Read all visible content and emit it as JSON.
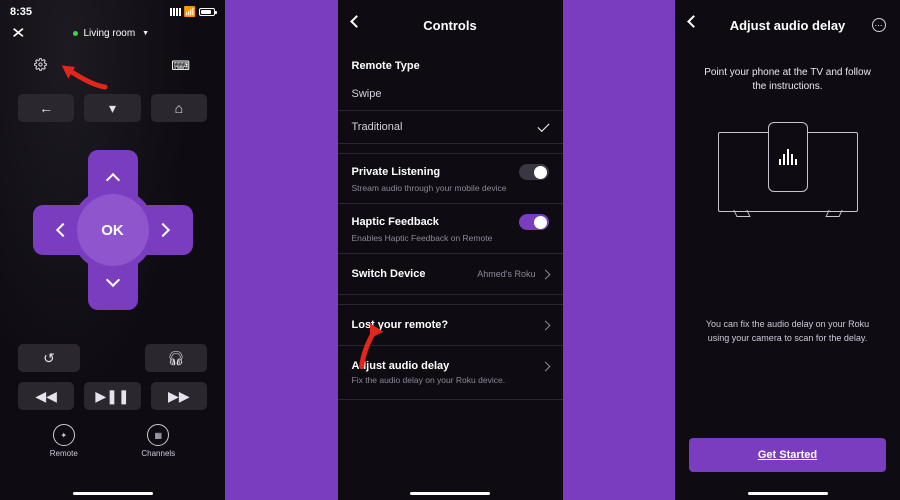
{
  "colors": {
    "accent": "#7a3dbf",
    "bg": "#0e0c12"
  },
  "s1": {
    "time": "8:35",
    "room": "Living room",
    "ok": "OK",
    "tabs": {
      "remote": "Remote",
      "channels": "Channels"
    }
  },
  "s2": {
    "title": "Controls",
    "remote_type": "Remote Type",
    "swipe": "Swipe",
    "traditional": "Traditional",
    "private": {
      "t": "Private Listening",
      "s": "Stream audio through your mobile device"
    },
    "haptic": {
      "t": "Haptic Feedback",
      "s": "Enables Haptic Feedback on Remote"
    },
    "switch": {
      "t": "Switch Device",
      "v": "Ahmed's Roku"
    },
    "lost": "Lost your remote?",
    "delay": {
      "t": "Adjust audio delay",
      "s": "Fix the audio delay on your Roku device."
    }
  },
  "s3": {
    "title": "Adjust audio delay",
    "instr": "Point your phone at the TV and follow the instructions.",
    "note": "You can fix the audio delay on your Roku using your camera to scan for the delay.",
    "cta": "Get Started"
  }
}
